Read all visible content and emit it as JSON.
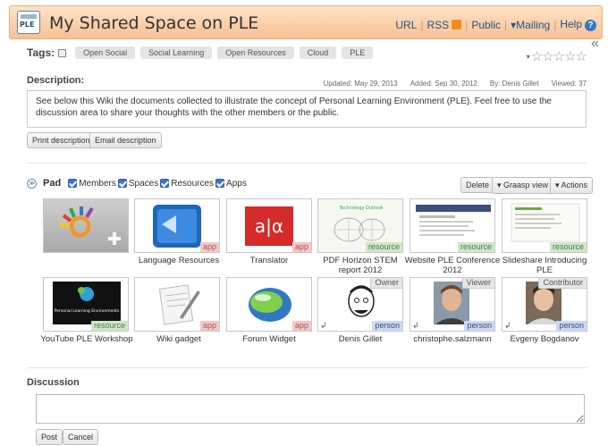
{
  "header": {
    "logo_text": "PLE",
    "title": "My Shared Space on PLE",
    "links": {
      "url": "URL",
      "rss": "RSS",
      "public": "Public",
      "mailing": "Mailing",
      "help": "Help"
    },
    "mailing_arrow": "▾",
    "help_glyph": "?",
    "collapse_glyph": "«"
  },
  "tags": {
    "label": "Tags:",
    "items": [
      "Open Social",
      "Social Learning",
      "Open Resources",
      "Cloud",
      "PLE"
    ]
  },
  "rating": {
    "stars": "☆☆☆☆☆",
    "arrow": "▾",
    "value": 0,
    "max": 5
  },
  "description": {
    "label": "Description:",
    "updated": "Updated: May 29, 2013",
    "added": "Added: Sep 30, 2012",
    "by": "By: Denis Gillet",
    "viewed": "Viewed: 37",
    "text": "See below this Wiki the documents collected to illustrate the concept of Personal Learning Environment (PLE). Feel free to use the discussion area to share your thoughts with the other members or the public.",
    "print_label": "Print description",
    "email_label": "Email description"
  },
  "pad": {
    "toggle_glyph": "≫",
    "label": "Pad",
    "filters": [
      "Members",
      "Spaces",
      "Resources",
      "Apps"
    ],
    "delete_label": "Delete",
    "view_label": "▾ Graasp view",
    "actions_label": "▾ Actions"
  },
  "items": [
    {
      "caption": "",
      "badge": "",
      "role": ""
    },
    {
      "caption": "Language Resources",
      "badge": "app",
      "role": ""
    },
    {
      "caption": "Translator",
      "badge": "app",
      "role": ""
    },
    {
      "caption": "PDF Horizon STEM report 2012",
      "badge": "resource",
      "role": ""
    },
    {
      "caption": "Website PLE Conference 2012",
      "badge": "resource",
      "role": ""
    },
    {
      "caption": "Slideshare Introducing PLE",
      "badge": "resource",
      "role": ""
    },
    {
      "caption": "YouTube PLE Workshop",
      "badge": "resource",
      "role": ""
    },
    {
      "caption": "Wiki gadget",
      "badge": "app",
      "role": ""
    },
    {
      "caption": "Forum Widget",
      "badge": "app",
      "role": ""
    },
    {
      "caption": "Denis Gillet",
      "badge": "person",
      "role": "Owner"
    },
    {
      "caption": "christophe.salzmann",
      "badge": "person",
      "role": "Viewer"
    },
    {
      "caption": "Evgeny Bogdanov",
      "badge": "person",
      "role": "Contributor"
    }
  ],
  "tile_text": {
    "translator_glyph": "a|α",
    "report_title": "Technology Outlook",
    "youtube_title": "Personal Learning Environments",
    "person_arrow": "↲"
  },
  "discussion": {
    "label": "Discussion",
    "input_value": "",
    "post_label": "Post",
    "cancel_label": "Cancel"
  }
}
